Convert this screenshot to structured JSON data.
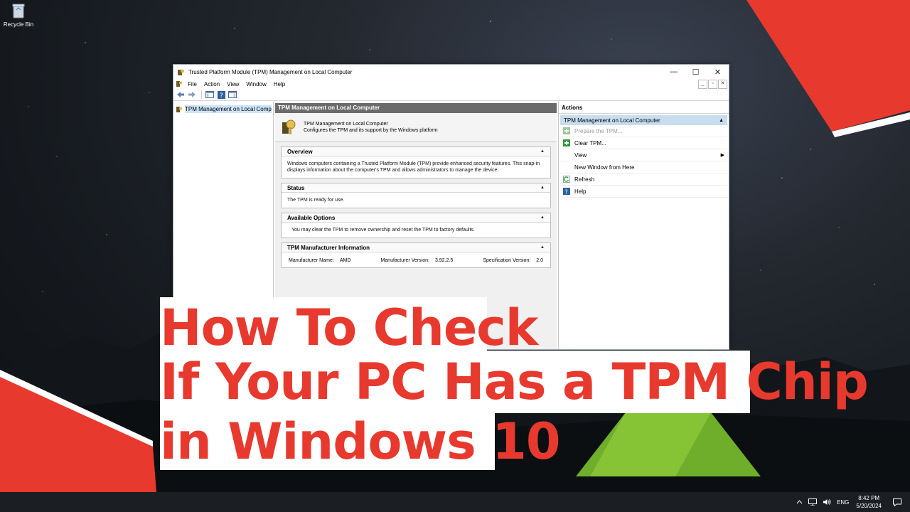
{
  "desktop": {
    "recycle_bin_label": "Recycle Bin"
  },
  "window": {
    "title": "Trusted Platform Module (TPM) Management on Local Computer",
    "controls": {
      "minimize": "—",
      "maximize": "☐",
      "close": "✕"
    },
    "menu": [
      "File",
      "Action",
      "View",
      "Window",
      "Help"
    ],
    "inner_controls": {
      "minimize": "_",
      "restore": "▫",
      "close": "✕"
    }
  },
  "tree": {
    "root_label": "TPM Management on Local Comp"
  },
  "center": {
    "header": "TPM Management on Local Computer",
    "banner_title": "TPM Management on Local Computer",
    "banner_subtitle": "Configures the TPM and its support by the Windows platform",
    "overview": {
      "title": "Overview",
      "text": "Windows computers containing a Trusted Platform Module (TPM) provide enhanced security features. This snap-in displays information about the computer's TPM and allows administrators to manage the device."
    },
    "status": {
      "title": "Status",
      "text": "The TPM is ready for use."
    },
    "available_options": {
      "title": "Available Options",
      "text": "You may clear the TPM to remove ownership and reset the TPM to factory defaults."
    },
    "manufacturer": {
      "title": "TPM Manufacturer Information",
      "name_label": "Manufacturer Name:",
      "name_value": "AMD",
      "version_label": "Manufacturer Version:",
      "version_value": "3.92.2.5",
      "spec_label": "Specification Version:",
      "spec_value": "2.0"
    },
    "collapse_glyph": "▲"
  },
  "actions": {
    "header": "Actions",
    "group_label": "TPM Management on Local Computer",
    "items": [
      {
        "label": "Prepare the TPM...",
        "enabled": false
      },
      {
        "label": "Clear TPM...",
        "enabled": true
      },
      {
        "label": "View",
        "enabled": true
      },
      {
        "label": "New Window from Here",
        "enabled": true
      },
      {
        "label": "Refresh",
        "enabled": true
      },
      {
        "label": "Help",
        "enabled": true
      }
    ]
  },
  "headline": {
    "line1": "How To Check",
    "line2": "If Your PC Has a TPM Chip",
    "line3": "in Windows 10",
    "color": "#e8392e"
  },
  "taskbar": {
    "language": "ENG",
    "time": "8:42 PM",
    "date": "5/20/2024"
  }
}
